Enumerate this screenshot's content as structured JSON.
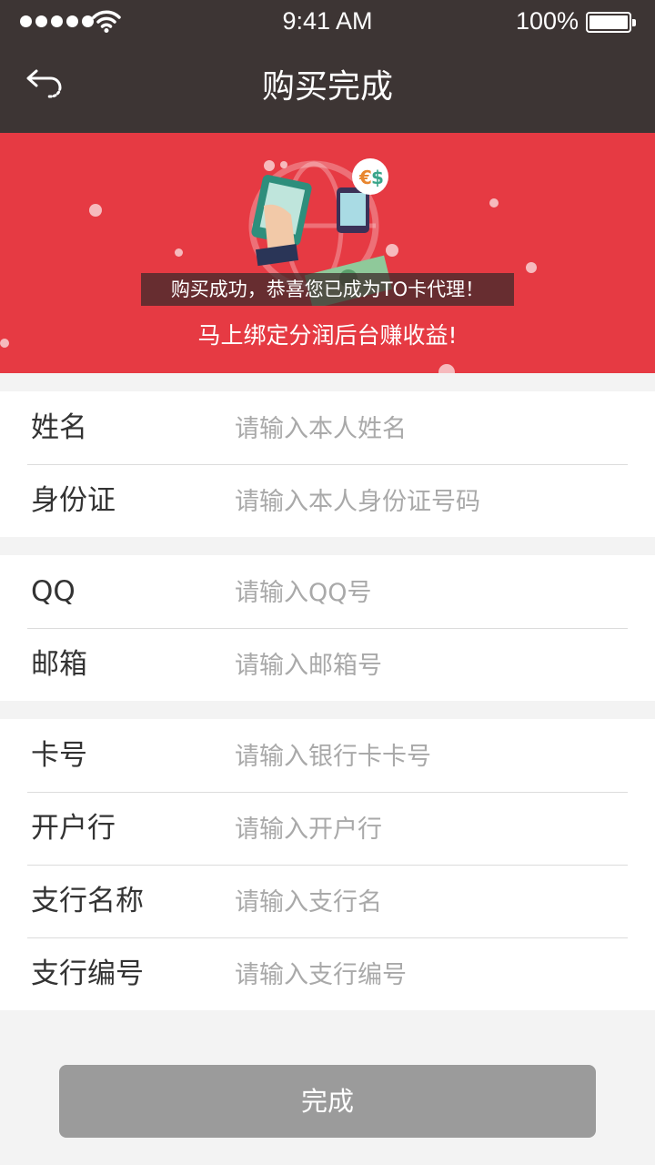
{
  "status_bar": {
    "time": "9:41 AM",
    "battery": "100%"
  },
  "nav": {
    "title": "购买完成",
    "back_icon": "back-arrow-icon"
  },
  "banner": {
    "message": "购买成功，恭喜您已成为TO卡代理！",
    "sub_message": "马上绑定分润后台赚收益!",
    "background_color": "#e63a43"
  },
  "groups": [
    {
      "rows": [
        {
          "label": "姓名",
          "placeholder": "请输入本人姓名"
        },
        {
          "label": "身份证",
          "placeholder": "请输入本人身份证号码"
        }
      ]
    },
    {
      "rows": [
        {
          "label": "QQ",
          "placeholder": "请输入QQ号"
        },
        {
          "label": "邮箱",
          "placeholder": "请输入邮箱号"
        }
      ]
    },
    {
      "rows": [
        {
          "label": "卡号",
          "placeholder": "请输入银行卡卡号"
        },
        {
          "label": "开户行",
          "placeholder": "请输入开户行"
        },
        {
          "label": "支行名称",
          "placeholder": "请输入支行名"
        },
        {
          "label": "支行编号",
          "placeholder": "请输入支行编号"
        }
      ]
    }
  ],
  "submit": {
    "label": "完成",
    "color": "#9b9b9b"
  }
}
